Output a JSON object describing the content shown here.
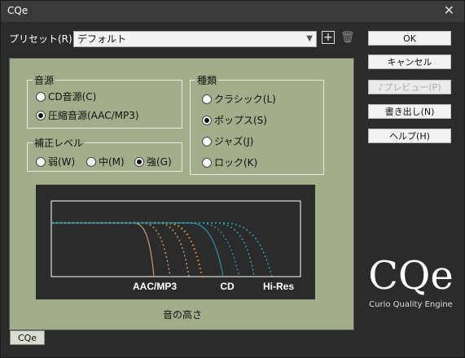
{
  "window": {
    "title": "CQe"
  },
  "preset": {
    "label": "プリセット(R):",
    "value": "デフォルト"
  },
  "buttons": {
    "ok": "OK",
    "cancel": "キャンセル",
    "preview": "♪プレビュー(P)",
    "export": "書き出し(N)",
    "help": "ヘルプ(H)"
  },
  "source": {
    "legend": "音源",
    "options": [
      "CD音源(C)",
      "圧縮音源(AAC/MP3)"
    ],
    "selected_index": 1
  },
  "level": {
    "legend": "補正レベル",
    "options": [
      "弱(W)",
      "中(M)",
      "強(G)"
    ],
    "selected_index": 2
  },
  "kind": {
    "legend": "種類",
    "options": [
      "クラシック(L)",
      "ポップス(S)",
      "ジャズ(J)",
      "ロック(K)"
    ],
    "selected_index": 1
  },
  "graph": {
    "labels": [
      "AAC/MP3",
      "CD",
      "Hi-Res"
    ],
    "x_axis_label": "音の高さ",
    "colors": {
      "aac": "#c59a6a",
      "highlight": "#f08a24",
      "cd": "#2f8fb0",
      "hires": "#2aa3a9"
    }
  },
  "logo": {
    "mark": "CQe",
    "subtitle": "Curio Quality Engine"
  },
  "tab": {
    "label": "CQe"
  }
}
